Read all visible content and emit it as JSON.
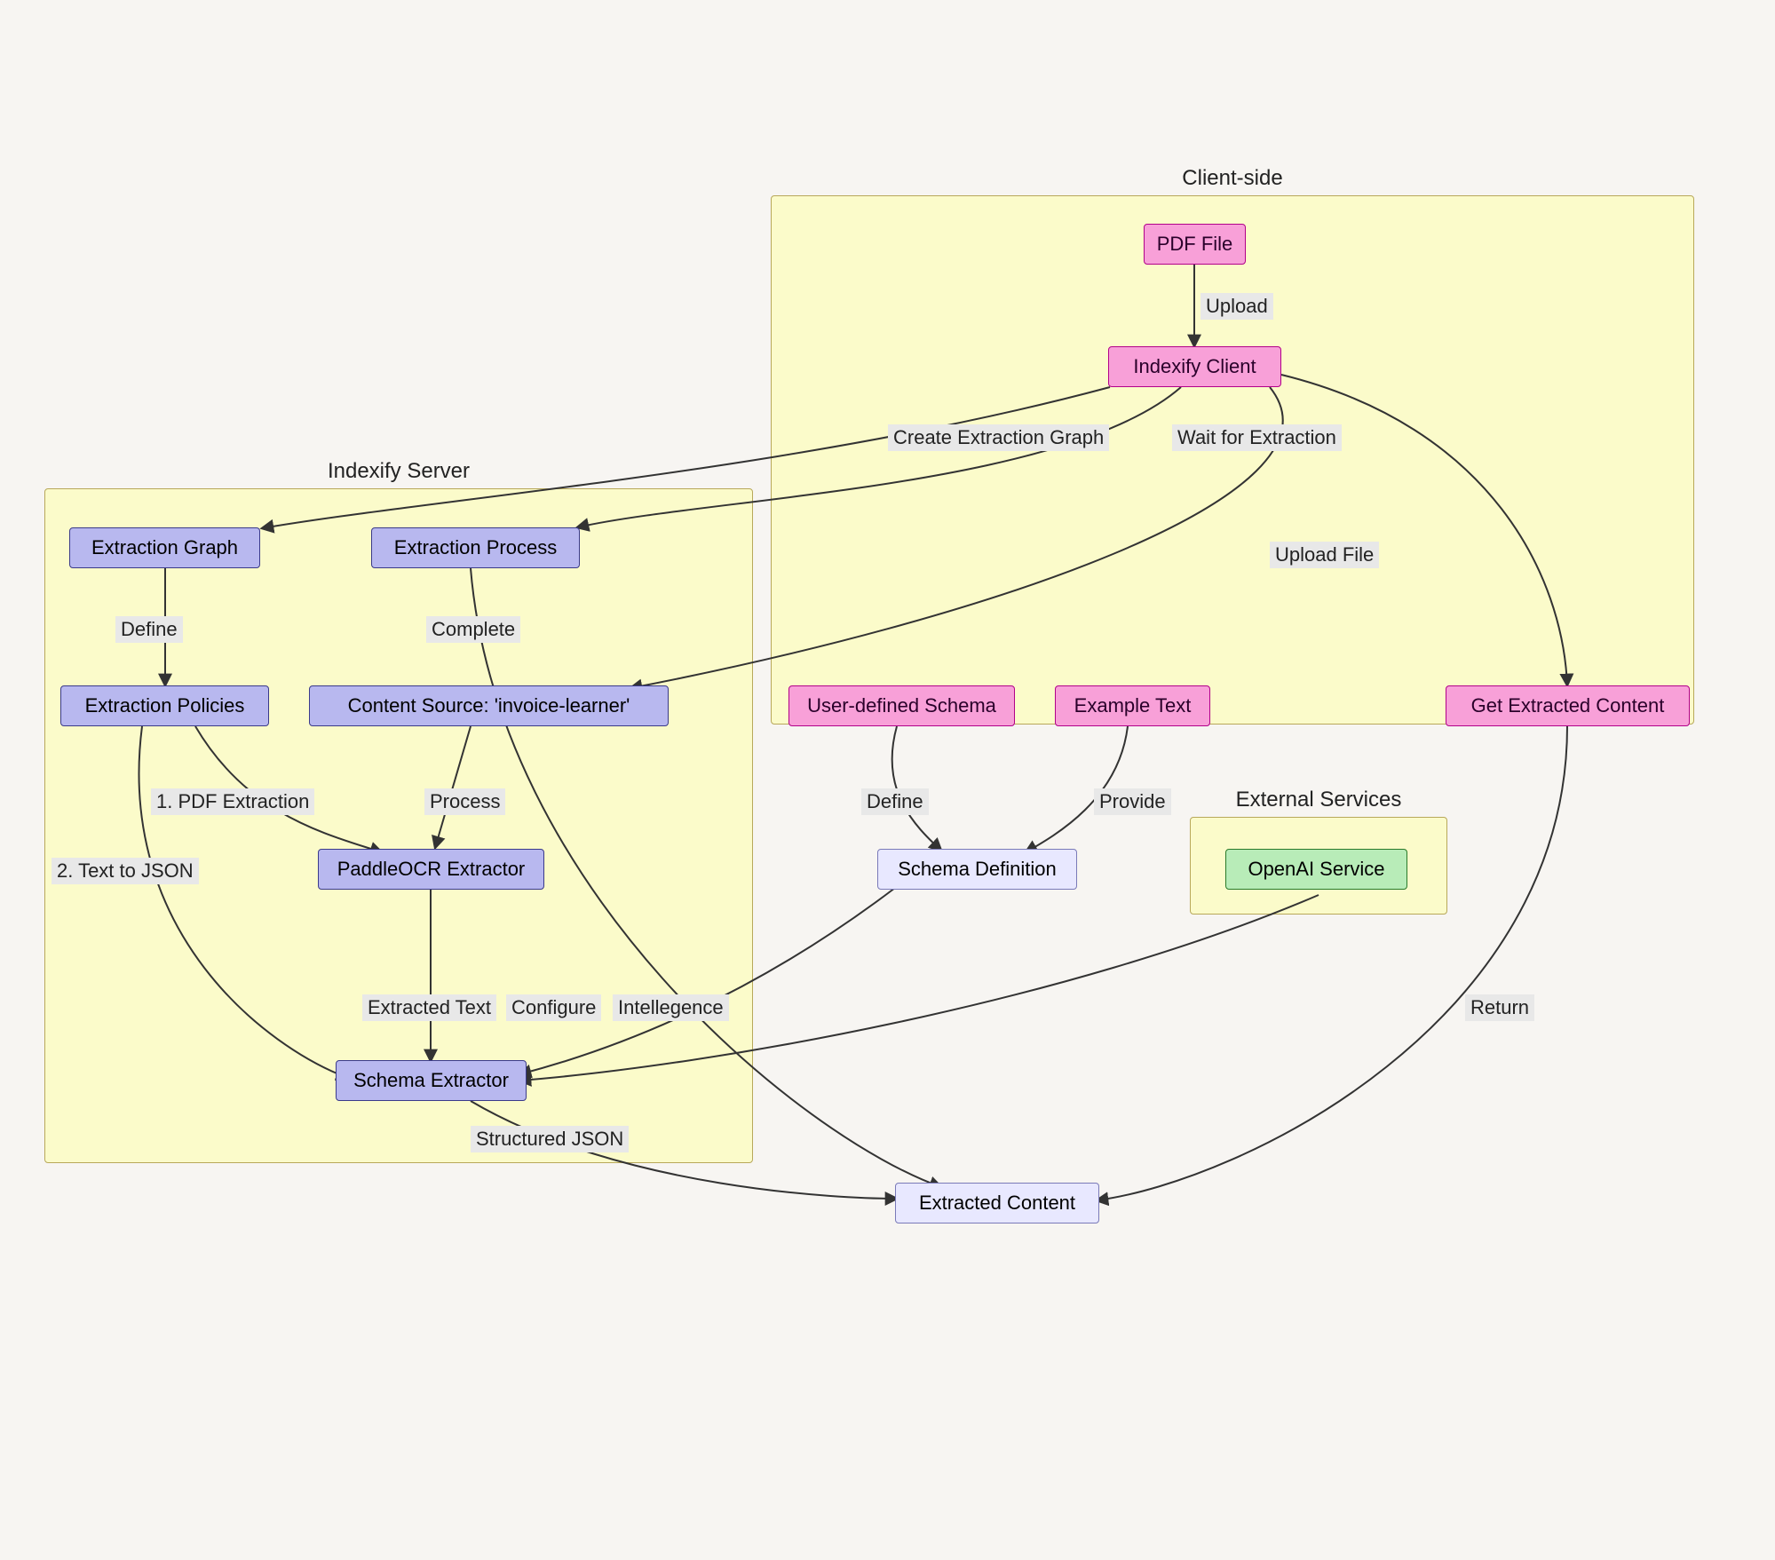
{
  "groups": {
    "client": {
      "title": "Client-side"
    },
    "server": {
      "title": "Indexify Server"
    },
    "external": {
      "title": "External Services"
    }
  },
  "nodes": {
    "pdf_file": {
      "label": "PDF File"
    },
    "indexify_client": {
      "label": "Indexify Client"
    },
    "user_schema": {
      "label": "User-defined Schema"
    },
    "example_text": {
      "label": "Example Text"
    },
    "get_extracted": {
      "label": "Get Extracted Content"
    },
    "extraction_graph": {
      "label": "Extraction Graph"
    },
    "extraction_process": {
      "label": "Extraction Process"
    },
    "extraction_policies": {
      "label": "Extraction Policies"
    },
    "content_source": {
      "label": "Content Source: 'invoice-learner'"
    },
    "paddleocr": {
      "label": "PaddleOCR Extractor"
    },
    "schema_extractor": {
      "label": "Schema Extractor"
    },
    "schema_definition": {
      "label": "Schema Definition"
    },
    "openai_service": {
      "label": "OpenAI Service"
    },
    "extracted_content": {
      "label": "Extracted Content"
    }
  },
  "edges": {
    "upload": {
      "label": "Upload"
    },
    "create_graph": {
      "label": "Create Extraction Graph"
    },
    "wait_extraction": {
      "label": "Wait for Extraction"
    },
    "upload_file": {
      "label": "Upload File"
    },
    "define": {
      "label": "Define"
    },
    "complete": {
      "label": "Complete"
    },
    "pdf_extraction": {
      "label": "1. PDF Extraction"
    },
    "process": {
      "label": "Process"
    },
    "text_to_json": {
      "label": "2. Text to JSON"
    },
    "extracted_text": {
      "label": "Extracted Text"
    },
    "configure": {
      "label": "Configure"
    },
    "intelligence": {
      "label": "Intellegence"
    },
    "define2": {
      "label": "Define"
    },
    "provide": {
      "label": "Provide"
    },
    "structured_json": {
      "label": "Structured JSON"
    },
    "return": {
      "label": "Return"
    }
  }
}
